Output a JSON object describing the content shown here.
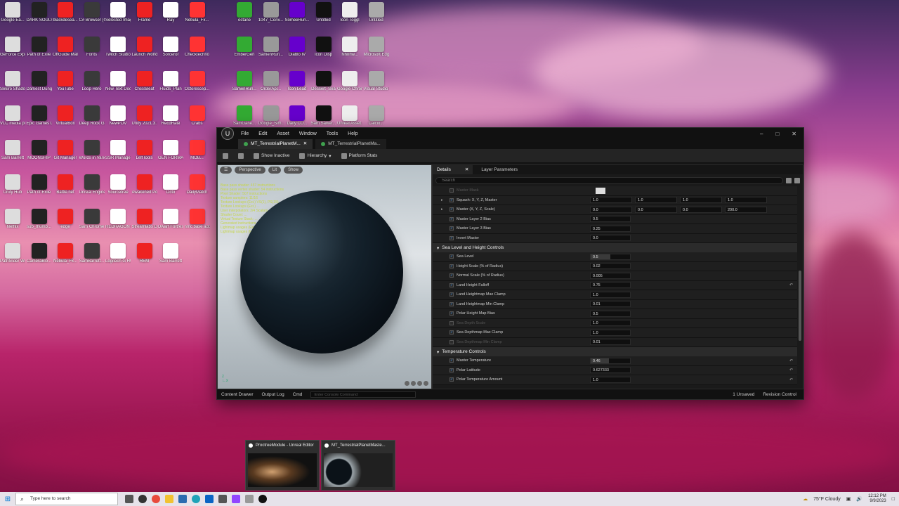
{
  "editor": {
    "menu": [
      "File",
      "Edit",
      "Asset",
      "Window",
      "Tools",
      "Help"
    ],
    "tabs": [
      "MT_TerrestrialPlanetM...",
      "MT_TerrestrialPlanetMa..."
    ],
    "toolbar": [
      "Show Inactive",
      "Hierarchy",
      "Platform Stats"
    ],
    "viewport": {
      "buttons": [
        "Perspective",
        "Lit",
        "Show"
      ],
      "stats": [
        "Base pass shader: 457 instructions",
        "Base pass vertex shader: 54 instructions",
        "Pixel Shader: 507 instructions",
        "Texture samplers: 11/16",
        "Texture Lookups (Est.) VS(1), PS(15)",
        "Texture Lookups (Est.) ...",
        "User interpolators: 2/4 Scalars",
        "Shader Count: ...",
        "Virtual Texture Stack: ...",
        "Generated instructions ...",
        "Lightmap usages (Est.): ...",
        "Lightmap usages (Est.): ..."
      ]
    },
    "details": {
      "tabs": [
        "Details",
        "Layer Parameters"
      ],
      "search_placeholder": "Search",
      "rows": [
        {
          "label": "Master Mask",
          "vals": [],
          "dim": true
        },
        {
          "label": "Squash: X, Y, Z, Master",
          "vals": [
            "1.0",
            "1.0",
            "1.0",
            "1.0"
          ],
          "expand": true
        },
        {
          "label": "Master (X, Y, Z, Scale)",
          "vals": [
            "0.0",
            "0.0",
            "0.0",
            "200.0"
          ],
          "expand": true
        },
        {
          "label": "Master Layer 2 Bias",
          "vals": [
            "0.5"
          ]
        },
        {
          "label": "Master Layer 3 Bias",
          "vals": [
            "0.25"
          ]
        },
        {
          "label": "Invert Master",
          "vals": [
            "0.0"
          ]
        }
      ],
      "section1": "Sea Level and Height Controls",
      "rows2": [
        {
          "label": "Sea Level",
          "vals": [
            "0.5"
          ],
          "fill": 50
        },
        {
          "label": "Height Scale (% of Radius)",
          "vals": [
            "0.02"
          ]
        },
        {
          "label": "Normal Scale (% of Radius)",
          "vals": [
            "0.005"
          ]
        },
        {
          "label": "Land Height Falloff",
          "vals": [
            "0.75"
          ],
          "reset": true
        },
        {
          "label": "Land Heightmap Max Clamp",
          "vals": [
            "1.0"
          ]
        },
        {
          "label": "Land Heightmap Min Clamp",
          "vals": [
            "0.01"
          ]
        },
        {
          "label": "Polar Height Map Bias",
          "vals": [
            "0.5"
          ]
        },
        {
          "label": "Sea Depth Scale",
          "vals": [
            "1.0"
          ],
          "dim": true
        },
        {
          "label": "Sea Depthmap Max Clamp",
          "vals": [
            "1.0"
          ]
        },
        {
          "label": "Sea Depthmap Min Clamp",
          "vals": [
            "0.01"
          ],
          "dim": true
        }
      ],
      "section2": "Temperature Controls",
      "rows3": [
        {
          "label": "Master Temperature",
          "vals": [
            "0.46"
          ],
          "fill": 46,
          "reset": true
        },
        {
          "label": "Polar Latitude",
          "vals": [
            "0.627333"
          ],
          "reset": true
        },
        {
          "label": "Polar Temperature Amount",
          "vals": [
            "1.0"
          ],
          "reset": true
        }
      ]
    },
    "status": [
      "Content Drawer",
      "Output Log",
      "Cmd",
      "Enter Console Command",
      "1 Unsaved",
      "Revision Control"
    ]
  },
  "desktop_icons": [
    "Google Ea...",
    "DARK SOULS III",
    "blackdesea...",
    "C# Browser (C)",
    "Selected Images",
    "Frame",
    "Ray",
    "Nebula_Fx...",
    "octane",
    "1047_Conv...",
    "SomeeRun...",
    "Untitled",
    "Icon Toggl",
    "Untitled",
    "GeForce Experience",
    "Path of Exile",
    "OffGuide Mall",
    "Fonts",
    "Twitch Studio",
    "Launch World...",
    "Sorceror",
    "Checktechno",
    "EmberGen",
    "SamenRun...",
    "Diablo IV",
    "Icon Disp",
    "Nhnhw...",
    "Microsoft Edge",
    "Sekiro Shadows Di...",
    "Darkest Dungeon",
    "YouTube",
    "Loop Hero",
    "New Text Document",
    "CrossBeat",
    "Fluids_Plan",
    "Octorescep...",
    "SamenRun...",
    "OrderApl...",
    "Icon Lead",
    "Dessert_Sea",
    "Google Chrome",
    "Visual Studio Code",
    "VLC media player",
    "Epic Games Launcher",
    "VirtualBox",
    "Deep Rock Galactic",
    "NewPOV",
    "Unity 2021.3.7",
    "RecdRate",
    "Crabs",
    "SamGane...",
    "Google_Sim...",
    "Daily CO...",
    "Sam Sawer...",
    "Unreal Asset...",
    "Calcio...",
    "Sam Barrett",
    "MOONSHIP",
    "Git Manager",
    "Words in Various",
    "SSR Manager",
    "LeftTools",
    "GEN FORMAT",
    "MOB...",
    "Steam",
    "Parsec",
    "Stella...",
    "Stella Firewall",
    "Chrome",
    "Adobe Sales",
    "Unity Hub",
    "Path of Exile",
    "Battle.net",
    "Unreal Engine",
    "Sourcetree",
    "Awakened PoE Trade",
    "Octo",
    "DailyMatch",
    "Hollow",
    "No Man's Sky",
    "World of Warcraft",
    "RGB Fusion 2.0",
    "CurseForge",
    "Canon TR4500 ser",
    "Netflix",
    "sub_thumb...",
    "edge",
    "Sam Chrome",
    "REDRAGON PERDITION",
    "Streamlabs Desktop",
    "Dwarf Fortress",
    "nmc base address",
    "TT16",
    "OctreeUniv...",
    "DARK SOULS Prepare To...",
    "Twitch",
    "GitHub Desktop",
    "lightworks x64 (2020.1)",
    "Pathfinder Wrath of t...",
    "CameraBlo...",
    "Nebula_Fx...",
    "SamBarrett...",
    "Logitech G HUB",
    "REM",
    "Sam Barrett"
  ],
  "previews": [
    "ProctreeModule - Unreal Editor",
    "MT_TerrestrialPlanetMaste..."
  ],
  "taskbar": {
    "search_placeholder": "Type here to search",
    "weather": "75°F Cloudy",
    "time": "12:12 PM",
    "date": "9/9/2023"
  }
}
